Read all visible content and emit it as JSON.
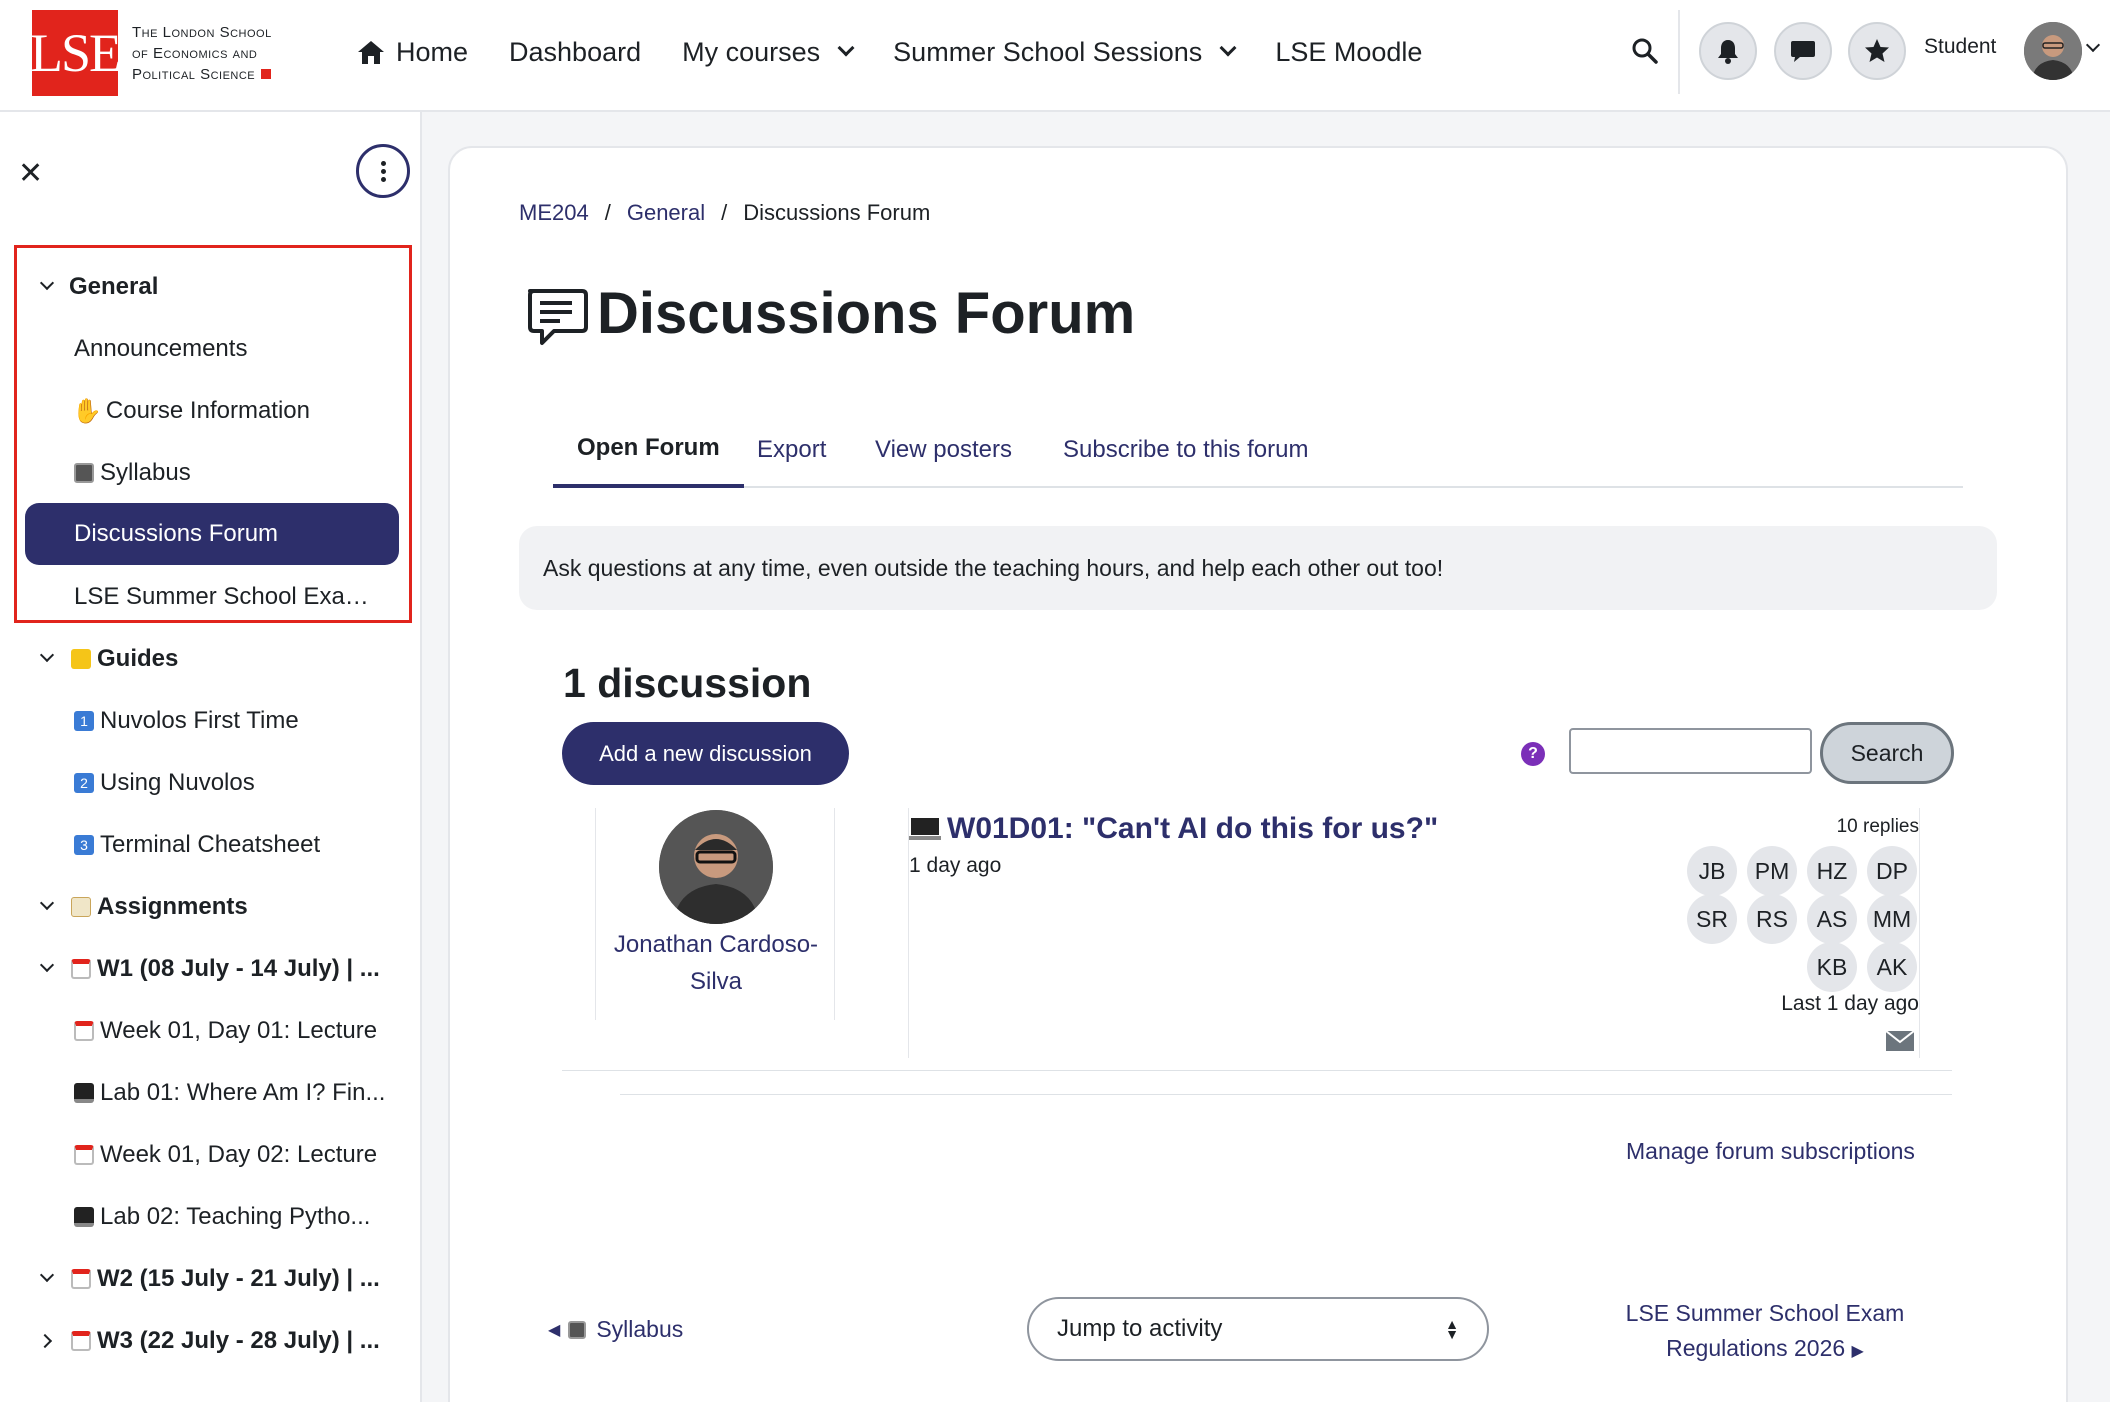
{
  "logo": {
    "mark": "LSE",
    "line1": "The London School",
    "line2": "of Economics and",
    "line3": "Political Science"
  },
  "nav": {
    "home": "Home",
    "dashboard": "Dashboard",
    "my_courses": "My courses",
    "summer_sessions": "Summer School Sessions",
    "lse_moodle": "LSE Moodle",
    "user": "Student"
  },
  "sidebar": {
    "items": [
      {
        "label": "General"
      },
      {
        "label": "Announcements"
      },
      {
        "label": "Course Information"
      },
      {
        "label": "Syllabus"
      },
      {
        "label": "Discussions Forum"
      },
      {
        "label": "LSE Summer School Exam ..."
      },
      {
        "label": "Guides"
      },
      {
        "label": "Nuvolos First Time"
      },
      {
        "label": "Using Nuvolos"
      },
      {
        "label": "Terminal Cheatsheet"
      },
      {
        "label": "Assignments"
      },
      {
        "label": "W1 (08 July - 14 July) | ..."
      },
      {
        "label": "Week 01, Day 01: Lecture"
      },
      {
        "label": "Lab 01: Where Am I? Fin..."
      },
      {
        "label": "Week 01, Day 02: Lecture"
      },
      {
        "label": "Lab 02: Teaching Pytho..."
      },
      {
        "label": "W2 (15 July - 21 July) | ..."
      },
      {
        "label": "W3 (22 July - 28 July) | ..."
      }
    ]
  },
  "breadcrumb": {
    "course": "ME204",
    "section": "General",
    "current": "Discussions Forum"
  },
  "page": {
    "title": "Discussions Forum"
  },
  "tabs": {
    "open_forum": "Open Forum",
    "export": "Export",
    "view_posters": "View posters",
    "subscribe": "Subscribe to this forum"
  },
  "intro": "Ask questions at any time, even outside the teaching hours, and help each other out too!",
  "discussions": {
    "count_label": "1 discussion",
    "add_button": "Add a new discussion",
    "search_button": "Search",
    "help": "?"
  },
  "post": {
    "author": "Jonathan Cardoso-Silva",
    "title": "W01D01: \"Can't AI do this for us?\"",
    "time": "1 day ago",
    "replies": "10 replies",
    "repliers": [
      "JB",
      "PM",
      "HZ",
      "DP",
      "SR",
      "RS",
      "AS",
      "MM",
      "KB",
      "AK"
    ],
    "last": "Last 1 day ago"
  },
  "manage_subscriptions": "Manage forum subscriptions",
  "footer_nav": {
    "prev": "Syllabus",
    "jump": "Jump to activity",
    "next_line1": "LSE Summer School Exam",
    "next_line2": "Regulations 2026"
  },
  "colors": {
    "brand_red": "#e1241c",
    "primary": "#2d2f6b"
  }
}
